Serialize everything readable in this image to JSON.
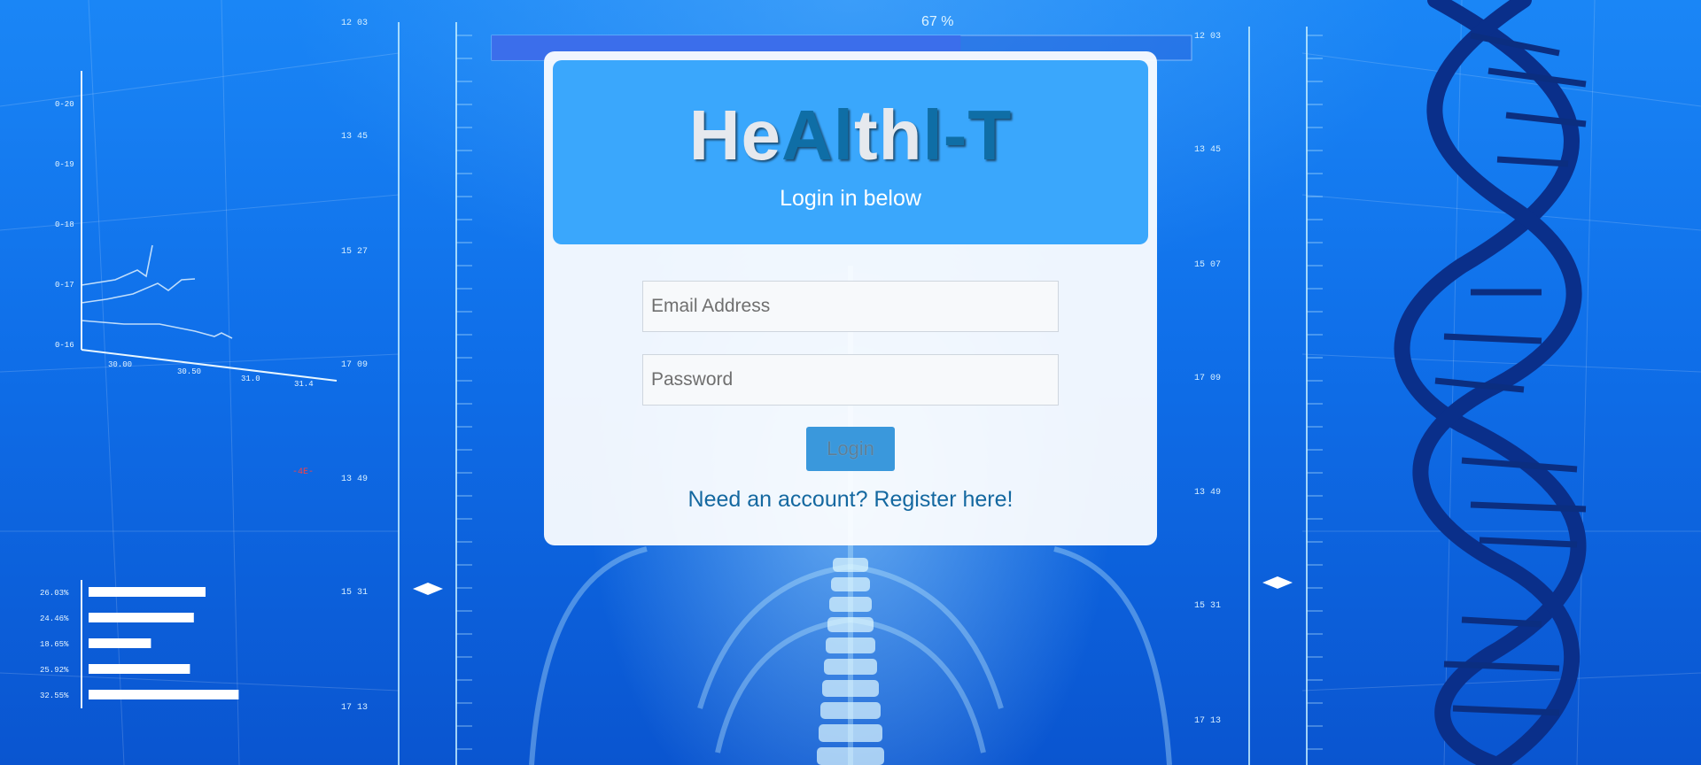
{
  "background": {
    "progress_label": "67 %",
    "progress": 0.67,
    "left_ruler_labels": [
      "12 03",
      "13 45",
      "15 27",
      "17 09",
      "13 49",
      "15 31",
      "17 13"
    ],
    "right_ruler_labels": [
      "12 03",
      "13 45",
      "15 07",
      "17 09",
      "13 49",
      "15 31",
      "17 13"
    ],
    "mini_chart_y_labels": [
      "0-20",
      "0-19",
      "0-18",
      "0-17",
      "0-16"
    ],
    "mini_chart_x_labels": [
      "30.00",
      "30.50",
      "31.0",
      "31.4"
    ],
    "bar_labels": [
      "26.03%",
      "24.46%",
      "18.65%",
      "25.92%",
      "32.55%"
    ],
    "bar_values": [
      0.6,
      0.54,
      0.32,
      0.52,
      0.77
    ]
  },
  "login": {
    "brand_parts": [
      {
        "text": "He",
        "tone": "light"
      },
      {
        "text": "Al",
        "tone": "dark"
      },
      {
        "text": "th",
        "tone": "light"
      },
      {
        "text": "l-T",
        "tone": "dark"
      }
    ],
    "subtitle": "Login in below",
    "email_placeholder": "Email Address",
    "password_placeholder": "Password",
    "login_button": "Login",
    "register_link": "Need an account? Register here!"
  },
  "colors": {
    "header_bg": "#3aa7fc",
    "brand_light": "#e6e9ee",
    "brand_dark": "#0f6ea6",
    "button_bg": "#3a98dc",
    "link": "#1468a0"
  }
}
